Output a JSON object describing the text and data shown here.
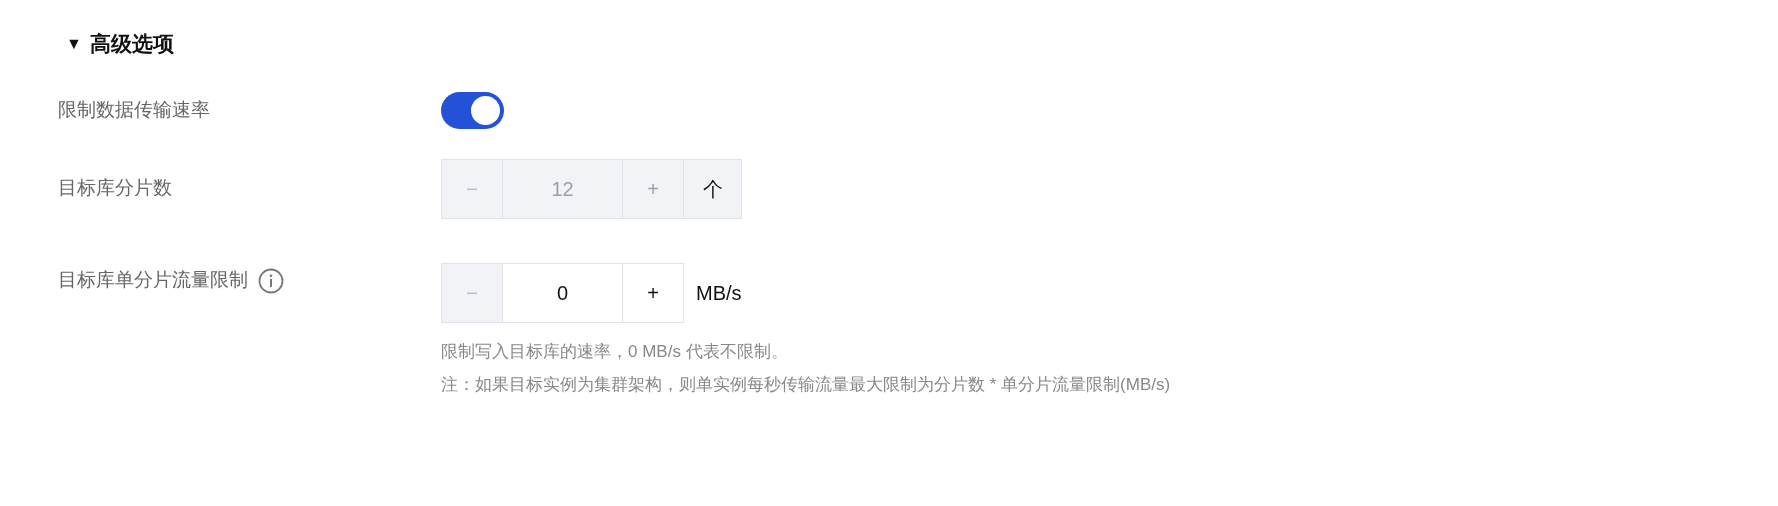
{
  "section": {
    "title": "高级选项",
    "expanded": true,
    "toggle_glyph": "▼"
  },
  "rows": [
    {
      "kind": "switch",
      "label": "限制数据传输速率",
      "on": true
    },
    {
      "kind": "stepper",
      "label": "目标库分片数",
      "disabled": true,
      "minus": "−",
      "value": "12",
      "plus": "+",
      "unit": {
        "kind": "addon",
        "text": "个"
      }
    },
    {
      "kind": "stepper",
      "label": "目标库单分片流量限制",
      "info": true,
      "disabled": false,
      "minus": "−",
      "value": "0",
      "plus": "+",
      "minus_disabled": true,
      "unit": {
        "kind": "suffix",
        "text": "MB/s"
      },
      "hints": [
        "限制写入目标库的速率，0 MB/s 代表不限制。",
        "注：如果目标实例为集群架构，则单实例每秒传输流量最大限制为分片数 * 单分片流量限制(MB/s)"
      ]
    }
  ]
}
